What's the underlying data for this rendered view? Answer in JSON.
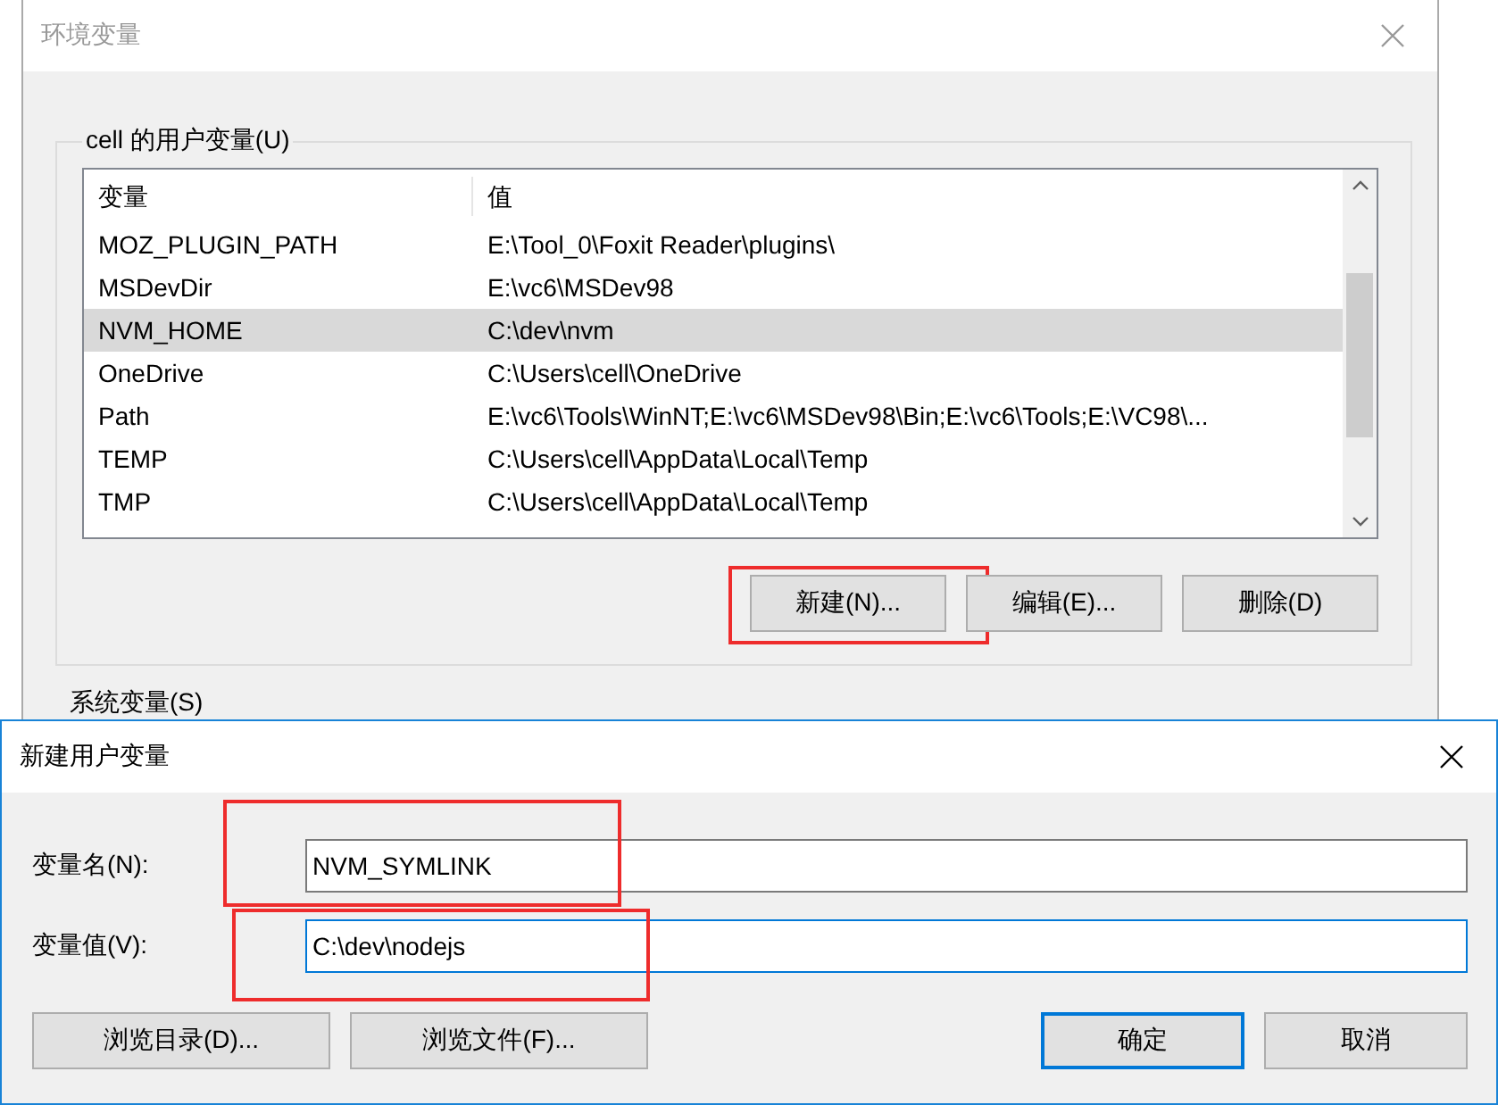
{
  "env_window": {
    "title": "环境变量",
    "user_group": {
      "label": "cell 的用户变量(U)",
      "columns": [
        "变量",
        "值"
      ],
      "rows": [
        {
          "name": "MOZ_PLUGIN_PATH",
          "value": "E:\\Tool_0\\Foxit Reader\\plugins\\",
          "selected": false
        },
        {
          "name": "MSDevDir",
          "value": "E:\\vc6\\MSDev98",
          "selected": false
        },
        {
          "name": "NVM_HOME",
          "value": "C:\\dev\\nvm",
          "selected": true
        },
        {
          "name": "OneDrive",
          "value": "C:\\Users\\cell\\OneDrive",
          "selected": false
        },
        {
          "name": "Path",
          "value": "E:\\vc6\\Tools\\WinNT;E:\\vc6\\MSDev98\\Bin;E:\\vc6\\Tools;E:\\VC98\\...",
          "selected": false
        },
        {
          "name": "TEMP",
          "value": "C:\\Users\\cell\\AppData\\Local\\Temp",
          "selected": false
        },
        {
          "name": "TMP",
          "value": "C:\\Users\\cell\\AppData\\Local\\Temp",
          "selected": false
        }
      ],
      "buttons": [
        {
          "label": "新建(N)...",
          "highlighted": true
        },
        {
          "label": "编辑(E)...",
          "highlighted": false
        },
        {
          "label": "删除(D)",
          "highlighted": false
        }
      ]
    },
    "system_group": {
      "label": "系统变量(S)"
    }
  },
  "new_var_dialog": {
    "title": "新建用户变量",
    "fields": [
      {
        "label": "变量名(N):",
        "value": "NVM_SYMLINK",
        "focused": false,
        "highlighted": true
      },
      {
        "label": "变量值(V):",
        "value": "C:\\dev\\nodejs",
        "focused": true,
        "highlighted": true
      }
    ],
    "left_buttons": [
      "浏览目录(D)...",
      "浏览文件(F)..."
    ],
    "right_buttons": [
      {
        "label": "确定",
        "default": true
      },
      {
        "label": "取消",
        "default": false
      }
    ]
  }
}
